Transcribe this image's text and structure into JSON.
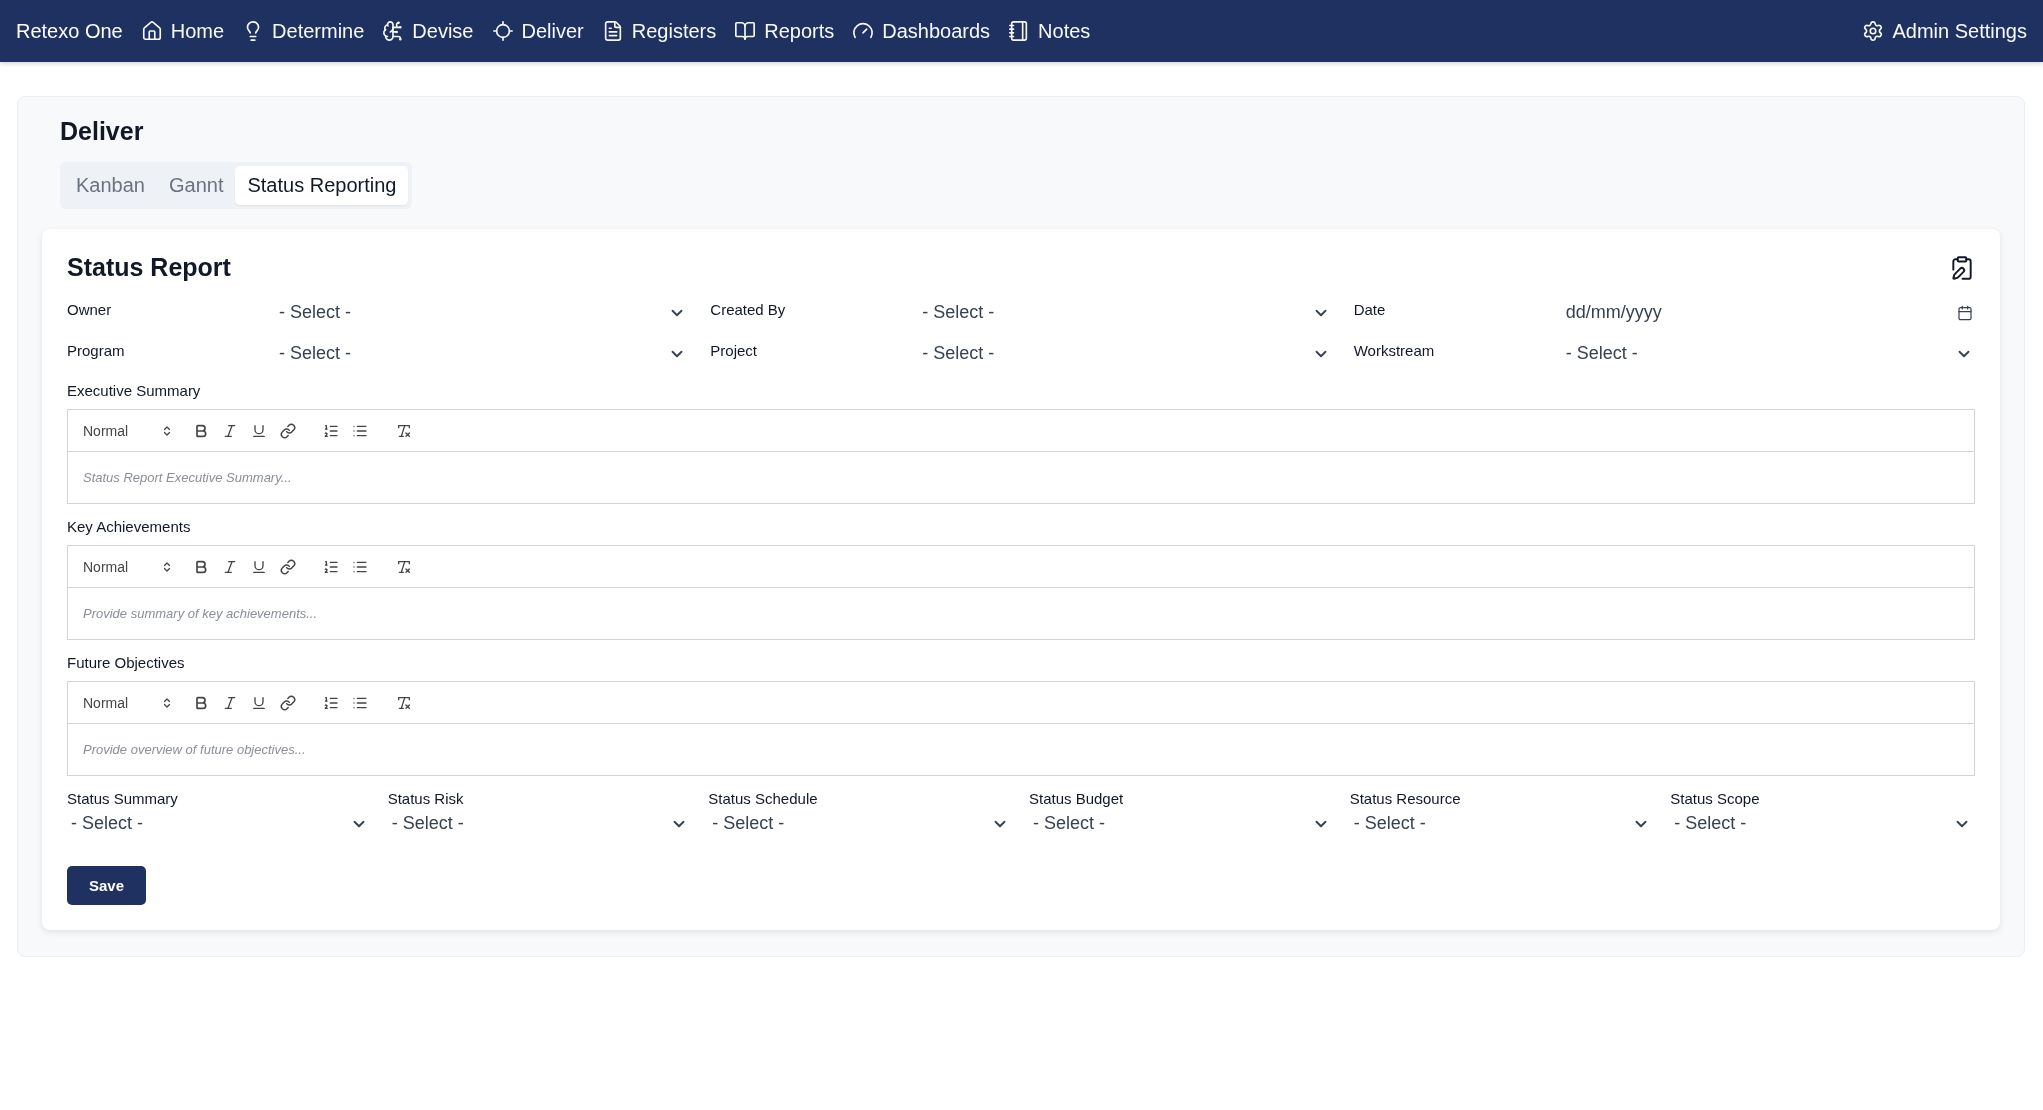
{
  "nav": {
    "brand": "Retexo One",
    "items": [
      {
        "label": "Home",
        "selected": false
      },
      {
        "label": "Determine",
        "selected": false
      },
      {
        "label": "Devise",
        "selected": false
      },
      {
        "label": "Deliver",
        "selected": false
      },
      {
        "label": "Registers",
        "selected": false
      },
      {
        "label": "Reports",
        "selected": false
      },
      {
        "label": "Dashboards",
        "selected": false
      },
      {
        "label": "Notes",
        "selected": false
      }
    ],
    "admin": "Admin Settings"
  },
  "page": {
    "title": "Deliver"
  },
  "tabs": [
    {
      "label": "Kanban",
      "selected": false
    },
    {
      "label": "Gannt",
      "selected": false
    },
    {
      "label": "Status Reporting",
      "selected": true
    }
  ],
  "report": {
    "title": "Status Report",
    "fields": [
      {
        "label": "Owner",
        "kind": "select",
        "value": "- Select -"
      },
      {
        "label": "Created By",
        "kind": "select",
        "value": "- Select -"
      },
      {
        "label": "Date",
        "kind": "date",
        "placeholder": "dd/mm/yyyy"
      },
      {
        "label": "Program",
        "kind": "select",
        "value": "- Select -"
      },
      {
        "label": "Project",
        "kind": "select",
        "value": "- Select -"
      },
      {
        "label": "Workstream",
        "kind": "select",
        "value": "- Select -"
      }
    ],
    "editors": [
      {
        "label": "Executive Summary",
        "format": "Normal",
        "placeholder": "Status Report Executive Summary..."
      },
      {
        "label": "Key Achievements",
        "format": "Normal",
        "placeholder": "Provide summary of key achievements..."
      },
      {
        "label": "Future Objectives",
        "format": "Normal",
        "placeholder": "Provide overview of future objectives..."
      }
    ],
    "status_fields": [
      {
        "label": "Status Summary",
        "value": "- Select -"
      },
      {
        "label": "Status Risk",
        "value": "- Select -"
      },
      {
        "label": "Status Schedule",
        "value": "- Select -"
      },
      {
        "label": "Status Budget",
        "value": "- Select -"
      },
      {
        "label": "Status Resource",
        "value": "- Select -"
      },
      {
        "label": "Status Scope",
        "value": "- Select -"
      }
    ],
    "save": "Save"
  }
}
